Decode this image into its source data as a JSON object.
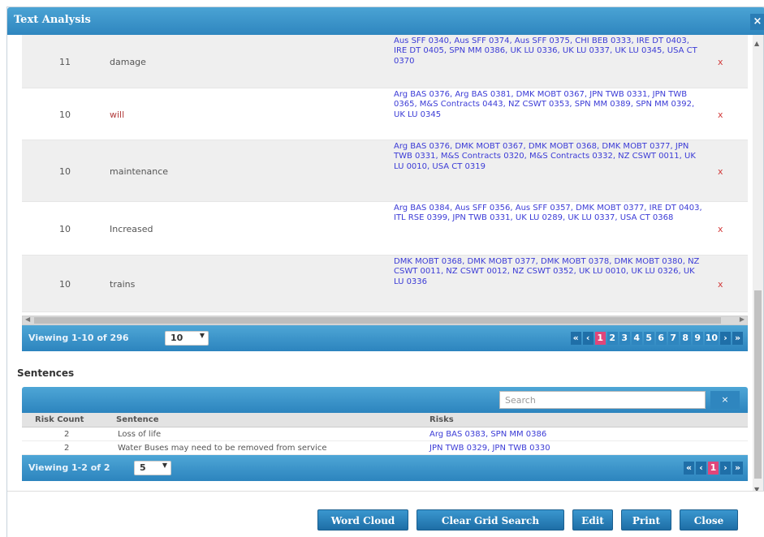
{
  "dialog": {
    "title": "Text Analysis",
    "close_glyph": "×"
  },
  "word_grid": {
    "rows": [
      {
        "count": "11",
        "word": "damage",
        "refs": "Aus SFF 0340, Aus SFF 0374, Aus SFF 0375, CHI BEB 0333, IRE DT 0403, IRE DT 0405, SPN MM 0386, UK LU 0336, UK LU 0337, UK LU 0345, USA CT 0370",
        "delete": "x"
      },
      {
        "count": "10",
        "word": "will",
        "refs": "Arg BAS 0376, Arg BAS 0381, DMK MOBT 0367, JPN TWB 0331, JPN TWB 0365, M&S Contracts 0443, NZ CSWT 0353, SPN MM 0389, SPN MM 0392, UK LU 0345",
        "delete": "x"
      },
      {
        "count": "10",
        "word": "maintenance",
        "refs": "Arg BAS 0376, DMK MOBT 0367, DMK MOBT 0368, DMK MOBT 0377, JPN TWB 0331, M&S Contracts 0320, M&S Contracts 0332, NZ CSWT 0011, UK LU 0010, USA CT 0319",
        "delete": "x"
      },
      {
        "count": "10",
        "word": "Increased",
        "refs": "Arg BAS 0384, Aus SFF 0356, Aus SFF 0357, DMK MOBT 0377, IRE DT 0403, ITL RSE 0399, JPN TWB 0331, UK LU 0289, UK LU 0337, USA CT 0368",
        "delete": "x"
      },
      {
        "count": "10",
        "word": "trains",
        "refs": "DMK MOBT 0368, DMK MOBT 0377, DMK MOBT 0378, DMK MOBT 0380, NZ CSWT 0011, NZ CSWT 0012, NZ CSWT 0352, UK LU 0010, UK LU 0326, UK LU 0336",
        "delete": "x"
      }
    ],
    "pager": {
      "viewing": "Viewing 1-10 of 296",
      "page_size": "10",
      "first": "«",
      "prev": "‹",
      "pages": [
        "1",
        "2",
        "3",
        "4",
        "5",
        "6",
        "7",
        "8",
        "9",
        "10"
      ],
      "next": "›",
      "last": "»"
    }
  },
  "sentences": {
    "heading": "Sentences",
    "search_placeholder": "Search",
    "search_button": "×",
    "columns": {
      "risk_count": "Risk Count",
      "sentence": "Sentence",
      "risks": "Risks"
    },
    "rows": [
      {
        "risk_count": "2",
        "sentence": "Loss of life",
        "risks": "Arg BAS 0383, SPN MM 0386"
      },
      {
        "risk_count": "2",
        "sentence": "Water Buses may need to be removed from service",
        "risks": "JPN TWB 0329, JPN TWB 0330"
      }
    ],
    "pager": {
      "viewing": "Viewing 1-2 of 2",
      "page_size": "5",
      "first": "«",
      "prev": "‹",
      "current": "1",
      "next": "›",
      "last": "»"
    }
  },
  "footer": {
    "word_cloud": "Word Cloud",
    "clear_grid_search": "Clear Grid Search",
    "edit": "Edit",
    "print": "Print",
    "close": "Close"
  }
}
